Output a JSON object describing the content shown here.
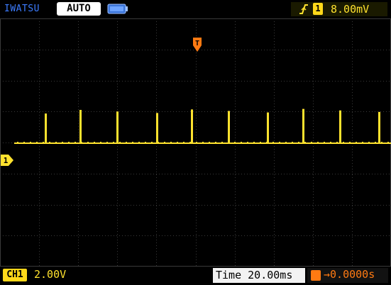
{
  "header": {
    "brand": "IWATSU",
    "mode": "AUTO",
    "battery_icon": "battery-icon",
    "trigger_edge_icon": "rising-edge-icon",
    "trigger_channel": "1",
    "trigger_level": "8.00mV"
  },
  "footer": {
    "ch1_badge": "CH1",
    "ch1_volts_div": "2.00V",
    "timebase": "Time 20.00ms",
    "trigger_delay": "→0.0000s"
  },
  "colors": {
    "background": "#000000",
    "grid": "#3a3a3a",
    "trace": "#ffe22e",
    "brand": "#3c7cff",
    "trigger_marker": "#ff7a12"
  },
  "trace": {
    "pulse_count": 10,
    "pulse_amplitude_div": 1.1
  }
}
